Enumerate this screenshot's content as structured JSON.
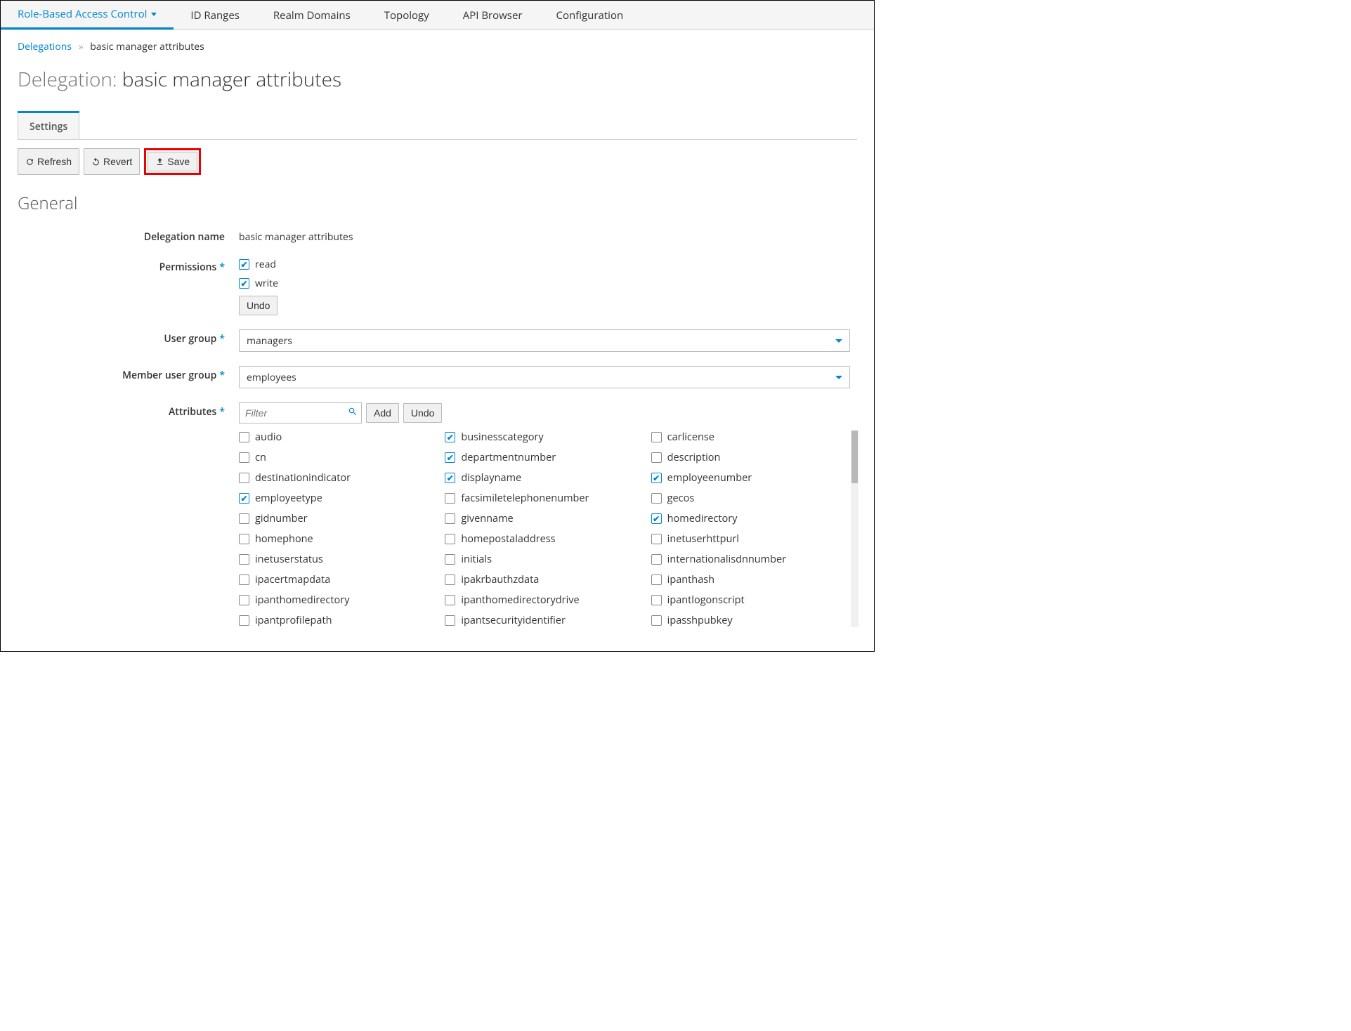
{
  "topnav": [
    {
      "label": "Role-Based Access Control",
      "active": true,
      "hasDropdown": true
    },
    {
      "label": "ID Ranges"
    },
    {
      "label": "Realm Domains"
    },
    {
      "label": "Topology"
    },
    {
      "label": "API Browser"
    },
    {
      "label": "Configuration"
    }
  ],
  "breadcrumb": {
    "parent": "Delegations",
    "current": "basic manager attributes"
  },
  "page_title_prefix": "Delegation: ",
  "page_title_value": "basic manager attributes",
  "tabs": [
    {
      "label": "Settings",
      "active": true
    }
  ],
  "toolbar": {
    "refresh": "Refresh",
    "revert": "Revert",
    "save": "Save"
  },
  "section": {
    "title": "General"
  },
  "form": {
    "delegation_name": {
      "label": "Delegation name",
      "value": "basic manager attributes"
    },
    "permissions": {
      "label": "Permissions",
      "options": [
        {
          "label": "read",
          "checked": true
        },
        {
          "label": "write",
          "checked": true
        }
      ],
      "undo_label": "Undo"
    },
    "user_group": {
      "label": "User group",
      "value": "managers"
    },
    "member_user_group": {
      "label": "Member user group",
      "value": "employees"
    },
    "attributes": {
      "label": "Attributes",
      "filter_placeholder": "Filter",
      "add_label": "Add",
      "undo_label": "Undo",
      "items": [
        {
          "label": "audio",
          "checked": false
        },
        {
          "label": "businesscategory",
          "checked": true
        },
        {
          "label": "carlicense",
          "checked": false
        },
        {
          "label": "cn",
          "checked": false
        },
        {
          "label": "departmentnumber",
          "checked": true
        },
        {
          "label": "description",
          "checked": false
        },
        {
          "label": "destinationindicator",
          "checked": false
        },
        {
          "label": "displayname",
          "checked": true
        },
        {
          "label": "employeenumber",
          "checked": true
        },
        {
          "label": "employeetype",
          "checked": true
        },
        {
          "label": "facsimiletelephonenumber",
          "checked": false
        },
        {
          "label": "gecos",
          "checked": false
        },
        {
          "label": "gidnumber",
          "checked": false
        },
        {
          "label": "givenname",
          "checked": false
        },
        {
          "label": "homedirectory",
          "checked": true
        },
        {
          "label": "homephone",
          "checked": false
        },
        {
          "label": "homepostaladdress",
          "checked": false
        },
        {
          "label": "inetuserhttpurl",
          "checked": false
        },
        {
          "label": "inetuserstatus",
          "checked": false
        },
        {
          "label": "initials",
          "checked": false
        },
        {
          "label": "internationalisdnnumber",
          "checked": false
        },
        {
          "label": "ipacertmapdata",
          "checked": false
        },
        {
          "label": "ipakrbauthzdata",
          "checked": false
        },
        {
          "label": "ipanthash",
          "checked": false
        },
        {
          "label": "ipanthomedirectory",
          "checked": false
        },
        {
          "label": "ipanthomedirectorydrive",
          "checked": false
        },
        {
          "label": "ipantlogonscript",
          "checked": false
        },
        {
          "label": "ipantprofilepath",
          "checked": false
        },
        {
          "label": "ipantsecurityidentifier",
          "checked": false
        },
        {
          "label": "ipasshpubkey",
          "checked": false
        }
      ]
    }
  }
}
